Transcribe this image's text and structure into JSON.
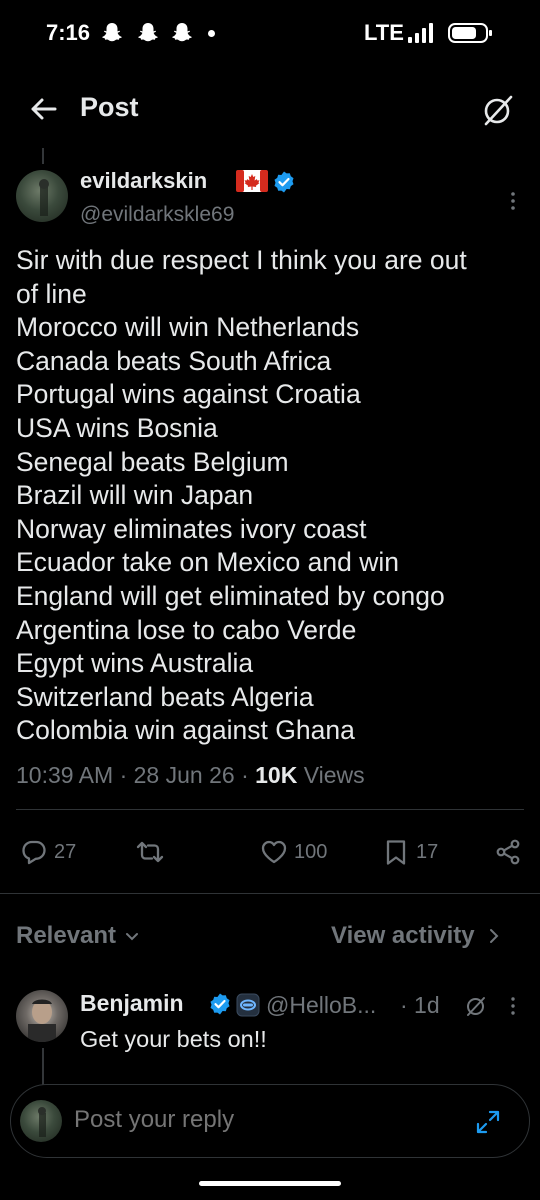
{
  "status_bar": {
    "time": "7:16",
    "network": "LTE",
    "notification_icons": [
      "snapchat-icon",
      "snapchat-icon",
      "snapchat-icon"
    ]
  },
  "header": {
    "title": "Post"
  },
  "tweet": {
    "author_name": "evildarkskin",
    "author_handle": "@evildarkskle69",
    "lines": [
      "Sir with due respect I think you are out",
      "of line",
      "Morocco will win Netherlands",
      "Canada beats South Africa",
      "Portugal wins against Croatia",
      "USA wins Bosnia",
      "Senegal beats Belgium",
      "Brazil will win Japan",
      "Norway eliminates ivory coast",
      "Ecuador take on Mexico and win",
      "England will get eliminated by congo",
      "Argentina lose to cabo Verde",
      "Egypt wins Australia",
      "Switzerland beats Algeria",
      "Colombia win against Ghana"
    ],
    "time": "10:39 AM",
    "date": "28 Jun 26",
    "views_count": "10K",
    "views_label": "Views",
    "separator": "·",
    "actions": {
      "replies": "27",
      "likes": "100",
      "bookmarks": "17"
    }
  },
  "replies_section": {
    "sort_label": "Relevant",
    "activity_label": "View activity"
  },
  "reply": {
    "author_name": "Benjamin",
    "author_handle": "@HelloB...",
    "time": "· 1d",
    "text": "Get your bets on!!"
  },
  "compose": {
    "placeholder": "Post your reply"
  },
  "colors": {
    "background": "#000000",
    "text_primary": "#e7e9ea",
    "text_secondary": "#71767b",
    "verified_blue": "#1d9bf0",
    "divider": "#2f3336"
  }
}
